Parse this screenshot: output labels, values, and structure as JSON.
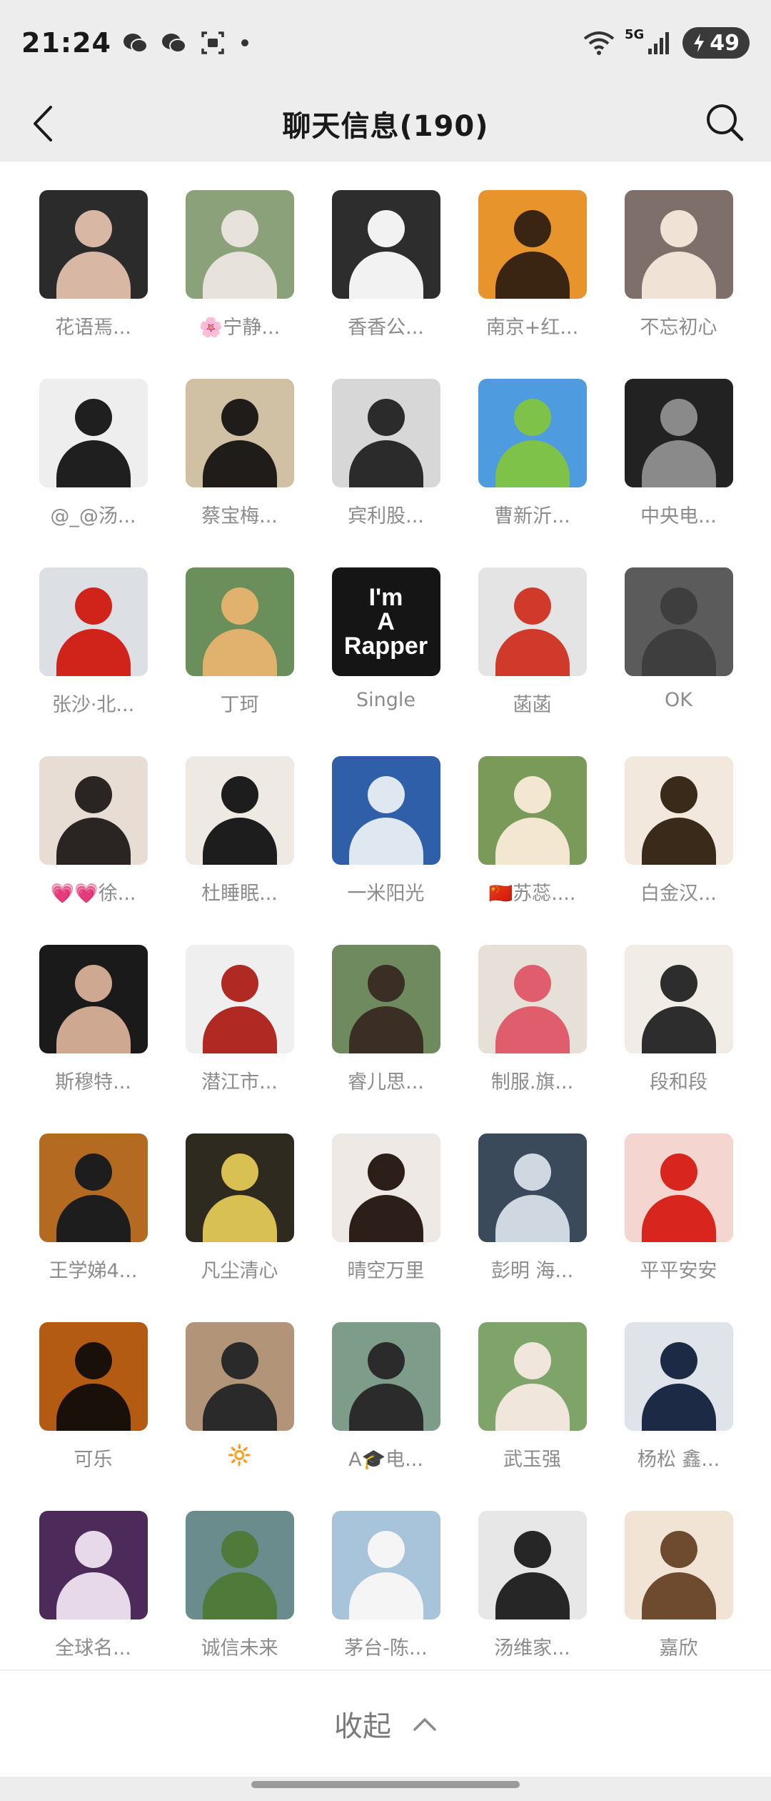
{
  "status_bar": {
    "time": "21:24",
    "network_label": "5G",
    "battery_level": "49",
    "icons": [
      "wechat-icon",
      "wechat-icon",
      "screenshot-icon",
      "wifi-icon",
      "signal-icon",
      "battery-icon"
    ]
  },
  "header": {
    "title": "聊天信息(190)",
    "back_icon": "chevron-left-icon",
    "search_icon": "search-icon"
  },
  "members": [
    {
      "name": "花语焉...",
      "bg": "#2b2b2b",
      "fg": "#d9b7a5"
    },
    {
      "name": "🌸宁静...",
      "bg": "#8aa17a",
      "fg": "#e7e2dc"
    },
    {
      "name": "香香公...",
      "bg": "#2d2d2d",
      "fg": "#f2f2f2"
    },
    {
      "name": "南京+红...",
      "bg": "#e8942c",
      "fg": "#3a2412"
    },
    {
      "name": "不忘初心",
      "bg": "#7e6f6a",
      "fg": "#f1e2d6"
    },
    {
      "name": "@_@汤...",
      "bg": "#eeeeee",
      "fg": "#1f1f1f"
    },
    {
      "name": "蔡宝梅...",
      "bg": "#d1c1a4",
      "fg": "#1f1c1a"
    },
    {
      "name": "宾利股...",
      "bg": "#d7d7d7",
      "fg": "#2b2b2b"
    },
    {
      "name": "曹新沂...",
      "bg": "#4f9be0",
      "fg": "#7ec24a"
    },
    {
      "name": "中央电...",
      "bg": "#222222",
      "fg": "#8a8a8a"
    },
    {
      "name": "张沙·北...",
      "bg": "#dcdfe4",
      "fg": "#d0241a"
    },
    {
      "name": "丁珂",
      "bg": "#6b8f5a",
      "fg": "#e0b26e"
    },
    {
      "name": "Single",
      "bg": "#151515",
      "fg": "#ffffff",
      "text_lines": [
        "I'm",
        "A",
        "Rapper"
      ]
    },
    {
      "name": "菡菡",
      "bg": "#e4e4e4",
      "fg": "#d03a2a"
    },
    {
      "name": "OK",
      "bg": "#5b5b5b",
      "fg": "#3e3e3e"
    },
    {
      "name": "💗💗徐...",
      "bg": "#e8ddd4",
      "fg": "#2a2423"
    },
    {
      "name": "杜睡眠...",
      "bg": "#efe9e4",
      "fg": "#1d1d1d"
    },
    {
      "name": "一米阳光",
      "bg": "#2f5fa8",
      "fg": "#dfe7f0"
    },
    {
      "name": "🇨🇳苏蕊....",
      "bg": "#7a9a5a",
      "fg": "#f4e7d1"
    },
    {
      "name": "白金汉...",
      "bg": "#f3e8de",
      "fg": "#3a2a1a"
    },
    {
      "name": "斯穆特...",
      "bg": "#1a1a1a",
      "fg": "#cfa892"
    },
    {
      "name": "潜江市...",
      "bg": "#efefef",
      "fg": "#b02a23"
    },
    {
      "name": "睿儿思...",
      "bg": "#6f8a5e",
      "fg": "#3b2f25"
    },
    {
      "name": "制服.旗...",
      "bg": "#e6e0d8",
      "fg": "#e05d6e"
    },
    {
      "name": "段和段",
      "bg": "#f1ede6",
      "fg": "#2d2d2d"
    },
    {
      "name": "王学娣4...",
      "bg": "#b56a22",
      "fg": "#1d1d1d"
    },
    {
      "name": "凡尘清心",
      "bg": "#2e2a1f",
      "fg": "#d9c052"
    },
    {
      "name": "晴空万里",
      "bg": "#eee9e5",
      "fg": "#2c1f1a"
    },
    {
      "name": "彭明 海...",
      "bg": "#3b4a5a",
      "fg": "#cfd8e0"
    },
    {
      "name": "平平安安",
      "bg": "#f4d5cf",
      "fg": "#d8261f"
    },
    {
      "name": "可乐",
      "bg": "#b35b12",
      "fg": "#1a100a"
    },
    {
      "name": "🔆",
      "bg": "#b29478",
      "fg": "#2a2a2a"
    },
    {
      "name": "A🎓电...",
      "bg": "#7e9c8a",
      "fg": "#2b2b2b"
    },
    {
      "name": "武玉强",
      "bg": "#7fa46a",
      "fg": "#f0e6dc"
    },
    {
      "name": "杨松 鑫...",
      "bg": "#dfe4ea",
      "fg": "#1c2a46"
    },
    {
      "name": "全球名...",
      "bg": "#4c2b5a",
      "fg": "#e7d9ea"
    },
    {
      "name": "诚信未来",
      "bg": "#6a8c8c",
      "fg": "#4f7a3a"
    },
    {
      "name": "茅台-陈...",
      "bg": "#a8c4da",
      "fg": "#f5f5f5"
    },
    {
      "name": "汤维家...",
      "bg": "#e7e7e7",
      "fg": "#262626"
    },
    {
      "name": "嘉欣",
      "bg": "#f2e4d5",
      "fg": "#6e4a2f"
    }
  ],
  "footer": {
    "collapse_label": "收起",
    "collapse_icon": "chevron-up-icon"
  }
}
